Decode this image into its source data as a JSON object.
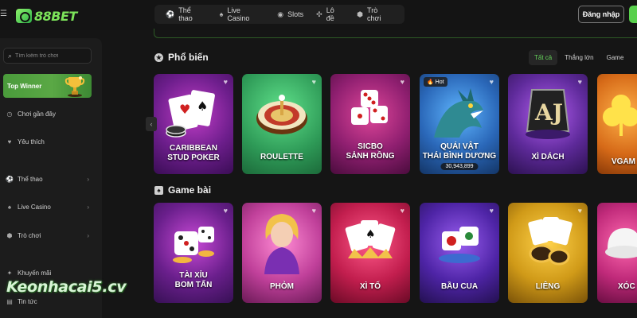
{
  "header": {
    "logo_text": "88BET",
    "nav": [
      {
        "label": "Thể thao",
        "icon": "sports-icon"
      },
      {
        "label": "Live Casino",
        "icon": "casino-icon"
      },
      {
        "label": "Slots",
        "icon": "slots-icon"
      },
      {
        "label": "Lô đề",
        "icon": "lottery-icon"
      },
      {
        "label": "Trò chơi",
        "icon": "games-icon"
      }
    ],
    "login_label": "Đăng nhập"
  },
  "sidebar": {
    "search_placeholder": "Tìm kiếm trò chơi",
    "top_winner": "Top Winner",
    "items": [
      {
        "label": "Chơi gần đây"
      },
      {
        "label": "Yêu thích"
      },
      {
        "label": "Thể thao"
      },
      {
        "label": "Live Casino"
      },
      {
        "label": "Trò chơi"
      },
      {
        "label": "Khuyến mãi"
      },
      {
        "label": "Tin tức"
      }
    ]
  },
  "watermark": "Keonhacai5.cv",
  "popular": {
    "title": "Phổ biến",
    "filters": [
      "Tất cả",
      "Thắng lớn",
      "Game"
    ],
    "active_filter": "Tất cả",
    "cards": [
      {
        "label": "CARIBBEAN\nSTUD POKER"
      },
      {
        "label": "ROULETTE"
      },
      {
        "label": "SICBO\nSẢNH RỒNG"
      },
      {
        "label": "QUÁI VẬT\nTHÁI BÌNH DƯƠNG",
        "badge": "Hot",
        "count": "30,943,899"
      },
      {
        "label": "XÌ DÁCH"
      },
      {
        "label": "VGAM"
      }
    ]
  },
  "cardgames": {
    "title": "Game bài",
    "cards": [
      {
        "label": "TÀI XỈU\nBOM TẤN"
      },
      {
        "label": "PHỎM"
      },
      {
        "label": "XÌ TỐ"
      },
      {
        "label": "BẦU CUA"
      },
      {
        "label": "LIÊNG"
      },
      {
        "label": "XÓC"
      }
    ]
  },
  "colors": {
    "accent": "#65d45a",
    "background": "#151515",
    "top_winner": "#4a9b3b"
  }
}
